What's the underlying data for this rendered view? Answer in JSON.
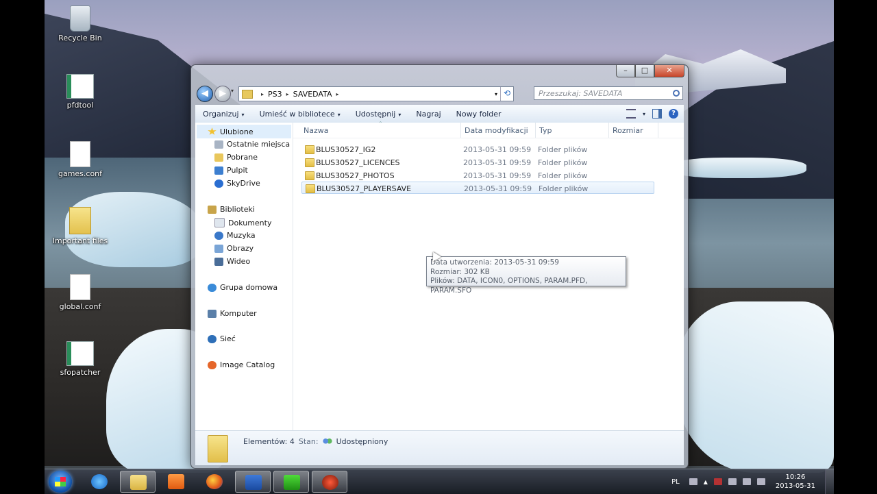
{
  "desktop": {
    "icons": [
      {
        "label": "Recycle Bin",
        "icon": "recycle-bin-icon"
      },
      {
        "label": "pfdtool",
        "icon": "app-icon"
      },
      {
        "label": "games.conf",
        "icon": "document-icon"
      },
      {
        "label": "Important files",
        "icon": "folder-icon"
      },
      {
        "label": "global.conf",
        "icon": "document-icon"
      },
      {
        "label": "sfopatcher",
        "icon": "app-icon"
      }
    ]
  },
  "explorer": {
    "window_controls": {
      "minimize": "–",
      "maximize": "□",
      "close": "✕"
    },
    "nav": {
      "back": "◀",
      "forward": "▶",
      "dropdown": "▾"
    },
    "address": {
      "segments": [
        "PS3",
        "SAVEDATA"
      ],
      "separator": "▸",
      "refresh": "⟲"
    },
    "search": {
      "placeholder": "Przeszukaj: SAVEDATA"
    },
    "toolbar": {
      "organize": "Organizuj",
      "include_library": "Umieść w bibliotece",
      "share": "Udostępnij",
      "burn": "Nagraj",
      "new_folder": "Nowy folder",
      "arrow": "▾",
      "help": "?"
    },
    "navpane": {
      "favorites": "Ulubione",
      "favorites_items": [
        "Ostatnie miejsca",
        "Pobrane",
        "Pulpit",
        "SkyDrive"
      ],
      "libraries": "Biblioteki",
      "libraries_items": [
        "Dokumenty",
        "Muzyka",
        "Obrazy",
        "Wideo"
      ],
      "homegroup": "Grupa domowa",
      "computer": "Komputer",
      "network": "Sieć",
      "image_catalog": "Image Catalog"
    },
    "columns": {
      "name": "Nazwa",
      "modified": "Data modyfikacji",
      "type": "Typ",
      "size": "Rozmiar"
    },
    "files": [
      {
        "name": "BLUS30527_IG2",
        "modified": "2013-05-31 09:59",
        "type": "Folder plików"
      },
      {
        "name": "BLUS30527_LICENCES",
        "modified": "2013-05-31 09:59",
        "type": "Folder plików"
      },
      {
        "name": "BLUS30527_PHOTOS",
        "modified": "2013-05-31 09:59",
        "type": "Folder plików"
      },
      {
        "name": "BLUS30527_PLAYERSAVE",
        "modified": "2013-05-31 09:59",
        "type": "Folder plików"
      }
    ],
    "tooltip": {
      "created": "Data utworzenia: 2013-05-31 09:59",
      "size": "Rozmiar: 302 KB",
      "files": "Plików: DATA, ICON0, OPTIONS, PARAM.PFD, PARAM.SFO"
    },
    "status": {
      "count": "Elementów: 4",
      "state_label": "Stan:",
      "state_value": "Udostępniony"
    }
  },
  "taskbar": {
    "apps": [
      "internet-explorer-icon",
      "file-explorer-icon",
      "media-player-icon",
      "firefox-icon",
      "word-icon",
      "green-app-icon",
      "red-app-icon"
    ],
    "tray": {
      "language": "PL",
      "time": "10:26",
      "date": "2013-05-31"
    }
  },
  "colors": {
    "accent": "#2b63c0",
    "folder": "#e7c85d",
    "selection": "#dfeefc"
  }
}
